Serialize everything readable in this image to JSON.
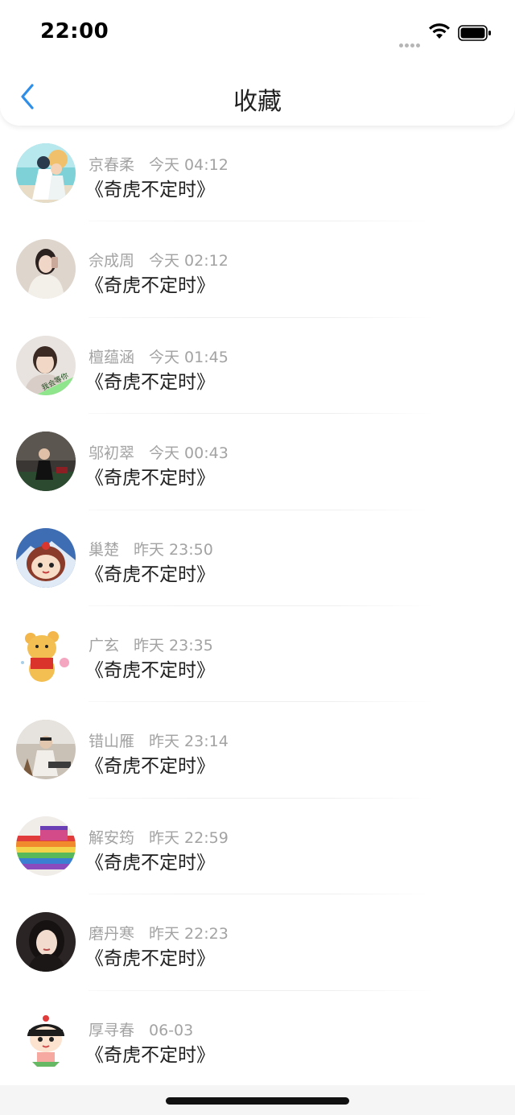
{
  "status_bar": {
    "time": "22:00",
    "icons": [
      "signal-dots-icon",
      "wifi-icon",
      "battery-icon"
    ]
  },
  "nav": {
    "title": "收藏",
    "back_icon": "chevron-left-icon",
    "accent_color": "#2f8fe8"
  },
  "items": [
    {
      "name": "京春柔",
      "time": "今天 04:12",
      "title": "《奇虎不定时》",
      "avatar": "couple-beach-avatar"
    },
    {
      "name": "佘成周",
      "time": "今天 02:12",
      "title": "《奇虎不定时》",
      "avatar": "girl-portrait-avatar"
    },
    {
      "name": "檀蕴涵",
      "time": "今天 01:45",
      "title": "《奇虎不定时》",
      "avatar": "boy-portrait-avatar"
    },
    {
      "name": "邬初翠",
      "time": "今天 00:43",
      "title": "《奇虎不定时》",
      "avatar": "dark-photo-avatar"
    },
    {
      "name": "巢楚",
      "time": "昨天 23:50",
      "title": "《奇虎不定时》",
      "avatar": "cartoon-girl-avatar"
    },
    {
      "name": "广玄",
      "time": "昨天 23:35",
      "title": "《奇虎不定时》",
      "avatar": "winnie-pooh-avatar"
    },
    {
      "name": "错山雁",
      "time": "昨天 23:14",
      "title": "《奇虎不定时》",
      "avatar": "man-sitting-avatar"
    },
    {
      "name": "解安筠",
      "time": "昨天 22:59",
      "title": "《奇虎不定时》",
      "avatar": "rainbow-cake-avatar"
    },
    {
      "name": "磨丹寒",
      "time": "昨天 22:23",
      "title": "《奇虎不定时》",
      "avatar": "woman-portrait-avatar"
    },
    {
      "name": "厚寻春",
      "time": "06-03",
      "title": "《奇虎不定时》",
      "avatar": "cartoon-kid-avatar"
    }
  ],
  "avatar_badge_text": "我会等你"
}
